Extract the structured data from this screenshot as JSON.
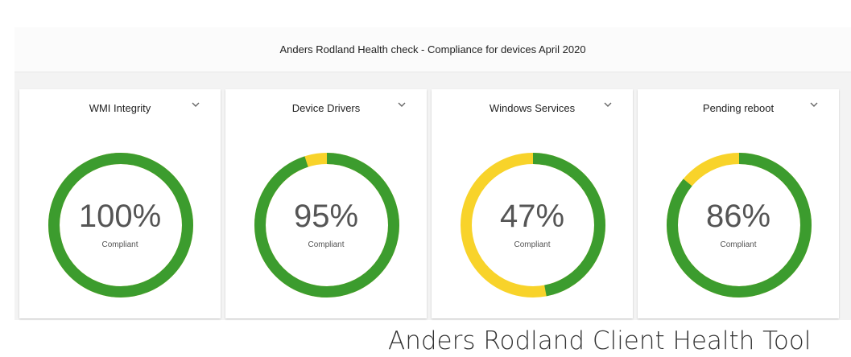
{
  "header": {
    "title": "Anders Rodland Health check - Compliance for devices April 2020"
  },
  "colors": {
    "compliant": "#3c9c2e",
    "noncompliant": "#f8d32a"
  },
  "tiles": [
    {
      "title": "WMI Integrity",
      "value": "100%",
      "percent": 100,
      "label": "Compliant",
      "menu_icon": "chevron-down-icon"
    },
    {
      "title": "Device Drivers",
      "value": "95%",
      "percent": 95,
      "label": "Compliant",
      "menu_icon": "chevron-down-icon"
    },
    {
      "title": "Windows Services",
      "value": "47%",
      "percent": 47,
      "label": "Compliant",
      "menu_icon": "chevron-down-icon"
    },
    {
      "title": "Pending reboot",
      "value": "86%",
      "percent": 86,
      "label": "Compliant",
      "menu_icon": "chevron-down-icon"
    }
  ],
  "footer": {
    "caption": "Anders Rodland Client Health Tool"
  }
}
